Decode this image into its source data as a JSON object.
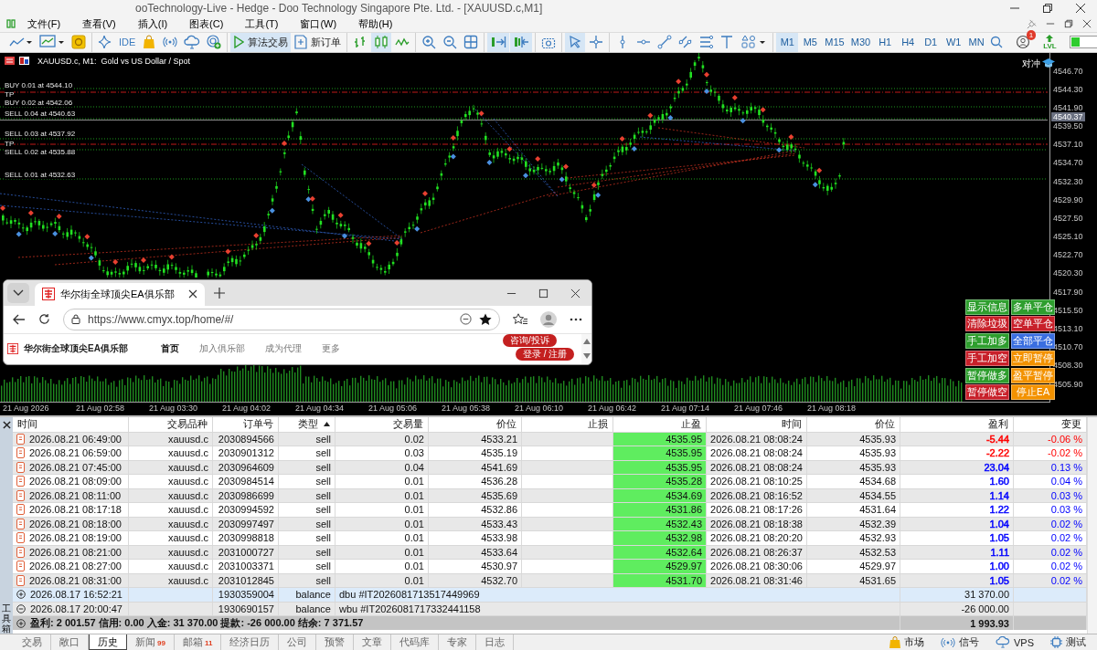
{
  "window": {
    "title": "ooTechnology-Live - Hedge - Doo Technology Singapore Pte. Ltd. - [XAUUSD.c,M1]"
  },
  "menu": [
    "文件(F)",
    "查看(V)",
    "插入(I)",
    "图表(C)",
    "工具(T)",
    "窗口(W)",
    "帮助(H)"
  ],
  "toolbar": {
    "groups": [
      [
        {
          "kind": "line-chart",
          "selected": false
        },
        {
          "kind": "template",
          "selected": false
        },
        {
          "kind": "money",
          "selected": false
        }
      ],
      [
        {
          "kind": "sparkle",
          "selected": false
        },
        {
          "kind": "ide",
          "label": "IDE",
          "selected": false
        },
        {
          "kind": "bag",
          "selected": false
        },
        {
          "kind": "signal",
          "selected": false
        },
        {
          "kind": "cloud",
          "selected": false
        },
        {
          "kind": "target",
          "selected": false
        }
      ],
      [
        {
          "kind": "algo",
          "label": "算法交易",
          "selected": true
        },
        {
          "kind": "new-order",
          "label": "新订单",
          "selected": false
        }
      ],
      [
        {
          "kind": "bars",
          "selected": false
        },
        {
          "kind": "candles",
          "selected": true
        },
        {
          "kind": "line",
          "selected": false
        }
      ],
      [
        {
          "kind": "zoom-in",
          "selected": false
        },
        {
          "kind": "zoom-out",
          "selected": false
        },
        {
          "kind": "grid",
          "selected": false
        }
      ],
      [
        {
          "kind": "autoscroll",
          "selected": true
        },
        {
          "kind": "shift",
          "selected": true
        }
      ],
      [
        {
          "kind": "camera",
          "selected": false
        }
      ],
      [
        {
          "kind": "cursor",
          "selected": true
        },
        {
          "kind": "crosshair",
          "selected": false
        }
      ],
      [
        {
          "kind": "vline",
          "selected": false
        },
        {
          "kind": "hline",
          "selected": false
        },
        {
          "kind": "trend",
          "selected": false
        },
        {
          "kind": "channel",
          "selected": false
        },
        {
          "kind": "fib",
          "selected": false
        },
        {
          "kind": "text",
          "selected": false
        },
        {
          "kind": "shapes",
          "selected": false
        }
      ]
    ],
    "timeframes": [
      {
        "label": "M1",
        "selected": true
      },
      {
        "label": "M5",
        "selected": false
      },
      {
        "label": "M15",
        "selected": false
      },
      {
        "label": "M30",
        "selected": false
      },
      {
        "label": "H1",
        "selected": false
      },
      {
        "label": "H4",
        "selected": false
      },
      {
        "label": "D1",
        "selected": false
      },
      {
        "label": "W1",
        "selected": false
      },
      {
        "label": "MN",
        "selected": false
      }
    ],
    "notification_count": "1",
    "lvl_label": "LVL"
  },
  "chart": {
    "title": "XAUUSD.c, M1:  Gold vs US Dollar / Spot",
    "hedge_label": "对冲",
    "order_lines": [
      {
        "kind": "order",
        "label": "BUY 0.01 at 4544.10"
      },
      {
        "kind": "tp",
        "label": "TP"
      },
      {
        "kind": "order",
        "label": "BUY 0.02 at 4542.06"
      },
      {
        "kind": "order",
        "label": "SELL 0.04 at 4540.63"
      },
      {
        "kind": "order",
        "label": "SELL 0.03 at 4537.92"
      },
      {
        "kind": "tp",
        "label": "TP"
      },
      {
        "kind": "order",
        "label": "SELL 0.02 at 4535.88"
      },
      {
        "kind": "order",
        "label": "SELL 0.01 at 4532.63"
      }
    ],
    "price_labels": [
      "4546.70",
      "4544.30",
      "4541.90",
      "4539.50",
      "4537.10",
      "4534.70",
      "4532.30",
      "4529.90",
      "4527.50",
      "4525.10",
      "4522.70",
      "4520.30",
      "4517.90",
      "4515.50",
      "4513.10",
      "4510.70",
      "4508.30",
      "4505.90"
    ],
    "current_price": "4540.37",
    "time_labels": [
      "21 Aug 2026",
      "21 Aug 02:58",
      "21 Aug 03:30",
      "21 Aug 04:02",
      "21 Aug 04:34",
      "21 Aug 05:06",
      "21 Aug 05:38",
      "21 Aug 06:10",
      "21 Aug 06:42",
      "21 Aug 07:14",
      "21 Aug 07:46",
      "21 Aug 08:18"
    ],
    "ea_buttons": [
      {
        "label": "显示信息",
        "color": "#2e9e2e"
      },
      {
        "label": "多单平仓",
        "color": "#2e9e2e"
      },
      {
        "label": "清除垃圾",
        "color": "#c8202a"
      },
      {
        "label": "空单平仓",
        "color": "#c8202a"
      },
      {
        "label": "手工加多",
        "color": "#2e9e2e"
      },
      {
        "label": "全部平仓",
        "color": "#3a6ee0"
      },
      {
        "label": "手工加空",
        "color": "#c8202a"
      },
      {
        "label": "立即暂停",
        "color": "#f39200"
      },
      {
        "label": "暂停做多",
        "color": "#2e9e2e"
      },
      {
        "label": "盈平暂停",
        "color": "#f39200"
      },
      {
        "label": "暂停做空",
        "color": "#c8202a"
      },
      {
        "label": "停止EA",
        "color": "#f39200"
      }
    ]
  },
  "browser": {
    "tab_title": "华尔街全球顶尖EA俱乐部",
    "url": "https://www.cmyx.top/home/#/",
    "site_name": "华尔街全球顶尖EA俱乐部",
    "nav": [
      {
        "label": "首页",
        "selected": true
      },
      {
        "label": "加入俱乐部",
        "selected": false
      },
      {
        "label": "成为代理",
        "selected": false
      },
      {
        "label": "更多",
        "selected": false
      }
    ],
    "buttons": [
      "咨询/投诉",
      "登录 / 注册"
    ]
  },
  "table": {
    "columns": [
      {
        "label": "时间",
        "sorted": false
      },
      {
        "label": "交易品种",
        "sorted": false
      },
      {
        "label": "订单号",
        "sorted": false
      },
      {
        "label": "类型",
        "sorted": true
      },
      {
        "label": "交易量",
        "sorted": false
      },
      {
        "label": "价位",
        "sorted": false
      },
      {
        "label": "止损",
        "sorted": false
      },
      {
        "label": "止盈",
        "sorted": false
      },
      {
        "label": "时间",
        "sorted": false
      },
      {
        "label": "价位",
        "sorted": false
      },
      {
        "label": "盈利",
        "sorted": false
      },
      {
        "label": "变更",
        "sorted": false
      }
    ],
    "rows": [
      {
        "kind": "trade",
        "selected": false,
        "color": "#ff0000",
        "cells": [
          "2026.08.21 06:49:00",
          "xauusd.c",
          "2030894566",
          "sell",
          "0.02",
          "4533.21",
          "",
          "4535.95",
          "2026.08.21 08:08:24",
          "4535.93",
          "-5.44",
          "-0.06 %"
        ]
      },
      {
        "kind": "trade",
        "selected": false,
        "color": "#ff0000",
        "cells": [
          "2026.08.21 06:59:00",
          "xauusd.c",
          "2030901312",
          "sell",
          "0.03",
          "4535.19",
          "",
          "4535.95",
          "2026.08.21 08:08:24",
          "4535.93",
          "-2.22",
          "-0.02 %"
        ]
      },
      {
        "kind": "trade",
        "selected": false,
        "color": "#0000ff",
        "cells": [
          "2026.08.21 07:45:00",
          "xauusd.c",
          "2030964609",
          "sell",
          "0.04",
          "4541.69",
          "",
          "4535.95",
          "2026.08.21 08:08:24",
          "4535.93",
          "23.04",
          "0.13 %"
        ]
      },
      {
        "kind": "trade",
        "selected": false,
        "color": "#0000ff",
        "cells": [
          "2026.08.21 08:09:00",
          "xauusd.c",
          "2030984514",
          "sell",
          "0.01",
          "4536.28",
          "",
          "4535.28",
          "2026.08.21 08:10:25",
          "4534.68",
          "1.60",
          "0.04 %"
        ]
      },
      {
        "kind": "trade",
        "selected": false,
        "color": "#0000ff",
        "cells": [
          "2026.08.21 08:11:00",
          "xauusd.c",
          "2030986699",
          "sell",
          "0.01",
          "4535.69",
          "",
          "4534.69",
          "2026.08.21 08:16:52",
          "4534.55",
          "1.14",
          "0.03 %"
        ]
      },
      {
        "kind": "trade",
        "selected": false,
        "color": "#0000ff",
        "cells": [
          "2026.08.21 08:17:18",
          "xauusd.c",
          "2030994592",
          "sell",
          "0.01",
          "4532.86",
          "",
          "4531.86",
          "2026.08.21 08:17:26",
          "4531.64",
          "1.22",
          "0.03 %"
        ]
      },
      {
        "kind": "trade",
        "selected": false,
        "color": "#0000ff",
        "cells": [
          "2026.08.21 08:18:00",
          "xauusd.c",
          "2030997497",
          "sell",
          "0.01",
          "4533.43",
          "",
          "4532.43",
          "2026.08.21 08:18:38",
          "4532.39",
          "1.04",
          "0.02 %"
        ]
      },
      {
        "kind": "trade",
        "selected": false,
        "color": "#0000ff",
        "cells": [
          "2026.08.21 08:19:00",
          "xauusd.c",
          "2030998818",
          "sell",
          "0.01",
          "4533.98",
          "",
          "4532.98",
          "2026.08.21 08:20:20",
          "4532.93",
          "1.05",
          "0.02 %"
        ]
      },
      {
        "kind": "trade",
        "selected": false,
        "color": "#0000ff",
        "cells": [
          "2026.08.21 08:21:00",
          "xauusd.c",
          "2031000727",
          "sell",
          "0.01",
          "4533.64",
          "",
          "4532.64",
          "2026.08.21 08:26:37",
          "4532.53",
          "1.11",
          "0.02 %"
        ]
      },
      {
        "kind": "trade",
        "selected": false,
        "color": "#0000ff",
        "cells": [
          "2026.08.21 08:27:00",
          "xauusd.c",
          "2031003371",
          "sell",
          "0.01",
          "4530.97",
          "",
          "4529.97",
          "2026.08.21 08:30:06",
          "4529.97",
          "1.00",
          "0.02 %"
        ]
      },
      {
        "kind": "trade",
        "selected": false,
        "color": "#0000ff",
        "cells": [
          "2026.08.21 08:31:00",
          "xauusd.c",
          "2031012845",
          "sell",
          "0.01",
          "4532.70",
          "",
          "4531.70",
          "2026.08.21 08:31:46",
          "4531.65",
          "1.05",
          "0.02 %"
        ]
      },
      {
        "kind": "deposit",
        "selected": true,
        "time": "2026.08.17 16:52:21",
        "order": "1930359004",
        "type": "balance",
        "comment": "dbu #IT2026081713517449969",
        "profit": "31 370.00"
      },
      {
        "kind": "withdrawal",
        "selected": false,
        "time": "2026.08.17 20:00:47",
        "order": "1930690157",
        "type": "balance",
        "comment": "wbu #IT2026081717332441158",
        "profit": "-26 000.00"
      }
    ],
    "summary": "盈利: 2 001.57  信用: 0.00  入金: 31 370.00  提款: -26 000.00  结余: 7 371.57",
    "total": "1 993.93"
  },
  "toolbox_label": "工具箱",
  "tabs": [
    {
      "label": "交易",
      "selected": false
    },
    {
      "label": "敞口",
      "selected": false
    },
    {
      "label": "历史",
      "selected": true
    },
    {
      "label": "新闻",
      "count": "99",
      "selected": false
    },
    {
      "label": "邮箱",
      "count": "11",
      "selected": false
    },
    {
      "label": "经济日历",
      "selected": false
    },
    {
      "label": "公司",
      "selected": false
    },
    {
      "label": "预警",
      "selected": false
    },
    {
      "label": "文章",
      "selected": false
    },
    {
      "label": "代码库",
      "selected": false
    },
    {
      "label": "专家",
      "selected": false
    },
    {
      "label": "日志",
      "selected": false
    }
  ],
  "status_items": [
    {
      "kind": "market",
      "label": "市场"
    },
    {
      "kind": "signals",
      "label": "信号"
    },
    {
      "kind": "vps",
      "label": "VPS"
    },
    {
      "kind": "tester",
      "label": "测试"
    }
  ]
}
